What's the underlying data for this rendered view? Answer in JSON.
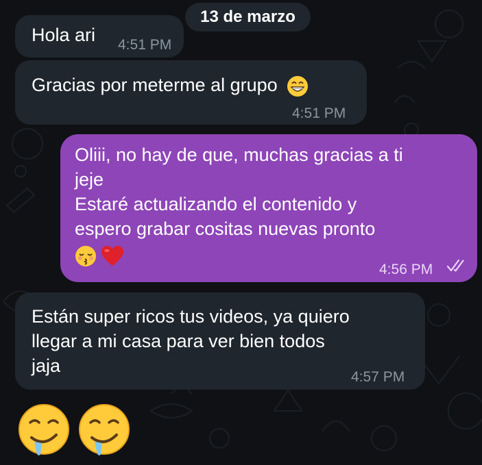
{
  "date_separator": "13 de marzo",
  "messages": [
    {
      "direction": "incoming",
      "text": "Hola ari",
      "time": "4:51 PM"
    },
    {
      "direction": "incoming",
      "text": "Gracias por meterme al grupo",
      "emoji": "grinning-face-with-smiling-eyes",
      "time": "4:51 PM"
    },
    {
      "direction": "outgoing",
      "lines": [
        "Oliii, no hay de que, muchas gracias a ti",
        "jeje",
        "Estaré actualizando el contenido y",
        "espero grabar cositas nuevas pronto"
      ],
      "emojis": [
        "kissing-face-with-closed-eyes",
        "red-heart"
      ],
      "time": "4:56 PM",
      "status": "double-check-read"
    },
    {
      "direction": "incoming",
      "lines": [
        "Están super ricos tus videos, ya quiero",
        "llegar a mi casa para ver bien todos",
        "jaja"
      ],
      "time": "4:57 PM"
    },
    {
      "direction": "incoming",
      "type": "emoji-only",
      "emojis": [
        "drooling-face",
        "drooling-face"
      ]
    }
  ],
  "colors": {
    "background": "#0f1114",
    "incoming_bubble": "#1f262d",
    "outgoing_bubble": "#8e45b8",
    "incoming_time": "#8b96a1",
    "outgoing_time": "#ead6f6"
  }
}
